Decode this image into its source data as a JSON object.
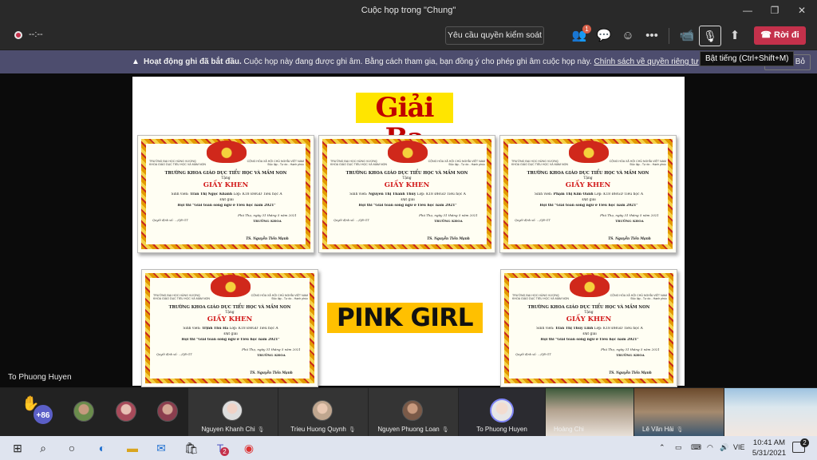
{
  "window": {
    "title": "Cuộc họp trong \"Chung\""
  },
  "toolbar": {
    "timer": "--:--",
    "request_control": "Yêu cầu quyền kiểm soát",
    "participants_badge": "1",
    "leave": "Rời đi",
    "mute_tooltip": "Bật tiếng (Ctrl+Shift+M)"
  },
  "banner": {
    "bold": "Hoạt động ghi đã bắt đầu.",
    "text": " Cuộc họp này đang được ghi âm. Bằng cách tham gia, bạn đồng ý cho phép ghi âm cuộc họp này. ",
    "link": "Chính sách về quyền riêng tư",
    "close_partial": "Bỏ"
  },
  "slide": {
    "title": "Giải Ba",
    "label": "PINK GIRL",
    "certificates": [
      {
        "student": "Trần Thị Ngọc Khánh"
      },
      {
        "student": "Nguyễn Thị Thanh Thúy"
      },
      {
        "student": "Phạm Thị Kim Oanh"
      },
      {
        "student": "Trịnh Thu Hà"
      },
      {
        "student": "Trần Thị Thùy Linh"
      }
    ],
    "cert_common": {
      "univ": "TRƯỜNG ĐẠI HỌC HÙNG VƯƠNG",
      "dept_small": "KHOA GIÁO DỤC TIỂU HỌC VÀ MẦM NON",
      "nation": "CỘNG HÒA XÃ HỘI CHỦ NGHĨA VIỆT NAM",
      "motto": "Độc lập - Tự do - Hạnh phúc",
      "dept": "TRƯỜNG KHOA GIÁO DỤC TIỂU HỌC VÀ MẦM NON",
      "tang": "Tặng",
      "heading": "GIẤY KHEN",
      "class_text": "Lớp: K18 ĐHGD Tiểu học A",
      "achieved": "Đạt giải",
      "contest": "Hội thi \"Giải toán song ngữ ở Tiểu học năm 2021\"",
      "place_date": "Phú Thọ, ngày 31 tháng 5 năm 2021",
      "dean": "TRƯỞNG KHOA",
      "dean_name": "TS. Nguyễn Tiến Mạnh",
      "decision": "Quyết định số: .../QĐ-GT"
    }
  },
  "presenter": {
    "name": "To Phuong Huyen"
  },
  "gallery": {
    "more_count": "+86",
    "tiles": [
      {
        "name": "Nguyen Khanh Chi"
      },
      {
        "name": "Trieu Huong Quynh"
      },
      {
        "name": "Nguyen Phuong Loan"
      },
      {
        "name": "To Phuong Huyen"
      },
      {
        "name": "Hoàng Chi"
      },
      {
        "name": "Lê Văn Hải"
      }
    ]
  },
  "taskbar": {
    "lang": "VIE",
    "time": "10:41 AM",
    "date": "5/31/2021",
    "notifications": "2",
    "teams_badge": "2"
  },
  "colors": {
    "leave": "#c4314b",
    "banner": "#4d4d6e",
    "title_highlight": "#ffe500",
    "label_highlight": "#ffc000",
    "title_text": "#c00000"
  }
}
